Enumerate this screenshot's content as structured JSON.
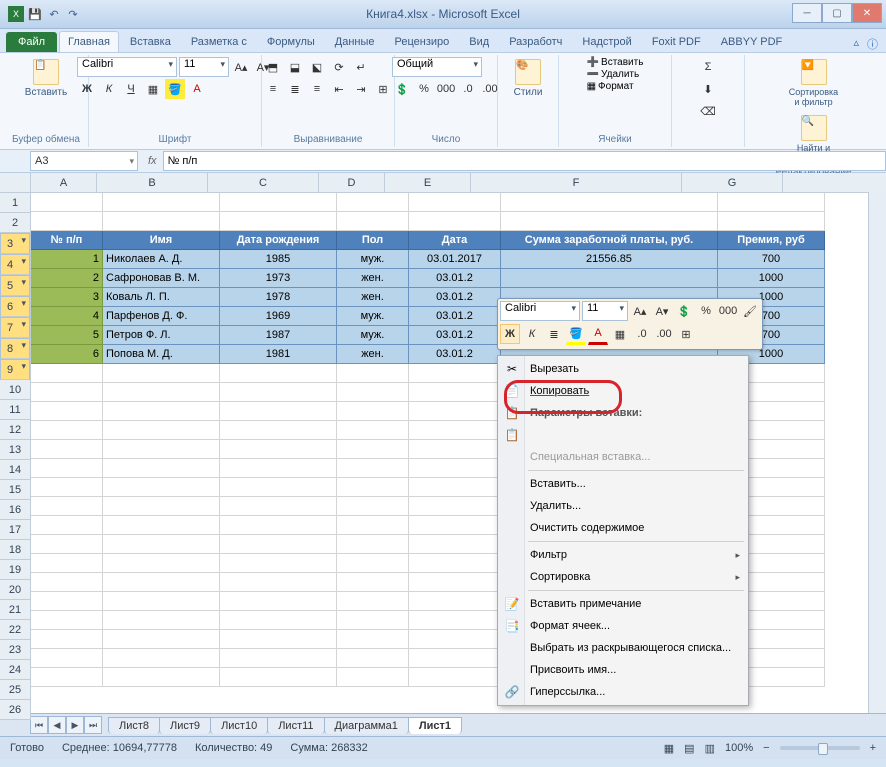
{
  "title": "Книга4.xlsx - Microsoft Excel",
  "tabs": {
    "file": "Файл",
    "home": "Главная",
    "insert": "Вставка",
    "layout": "Разметка с",
    "formulas": "Формулы",
    "data": "Данные",
    "review": "Рецензиро",
    "view": "Вид",
    "dev": "Разработч",
    "addin": "Надстрой",
    "foxit": "Foxit PDF",
    "abbyy": "ABBYY PDF"
  },
  "ribbon": {
    "clipboard": {
      "paste": "Вставить",
      "label": "Буфер обмена"
    },
    "font": {
      "name": "Calibri",
      "size": "11",
      "label": "Шрифт"
    },
    "align": {
      "label": "Выравнивание"
    },
    "number": {
      "fmt": "Общий",
      "label": "Число"
    },
    "styles": {
      "btn": "Стили"
    },
    "cells": {
      "insert": "Вставить",
      "delete": "Удалить",
      "format": "Формат",
      "label": "Ячейки"
    },
    "editing": {
      "sort": "Сортировка и фильтр",
      "find": "Найти и выделить",
      "label": "Редактирование"
    }
  },
  "namebox": "A3",
  "formula": "№ п/п",
  "cols": [
    "A",
    "B",
    "C",
    "D",
    "E",
    "F",
    "G"
  ],
  "header": [
    "№ п/п",
    "Имя",
    "Дата рождения",
    "Пол",
    "Дата",
    "Сумма заработной платы, руб.",
    "Премия, руб"
  ],
  "rows": [
    {
      "n": "1",
      "name": "Николаев А. Д.",
      "birth": "1985",
      "sex": "муж.",
      "date": "03.01.2017",
      "sum": "21556.85",
      "bonus": "700"
    },
    {
      "n": "2",
      "name": "Сафроновав В. М.",
      "birth": "1973",
      "sex": "жен.",
      "date": "03.01.2",
      "sum": "",
      "bonus": "1000"
    },
    {
      "n": "3",
      "name": "Коваль Л. П.",
      "birth": "1978",
      "sex": "жен.",
      "date": "03.01.2",
      "sum": "",
      "bonus": "1000"
    },
    {
      "n": "4",
      "name": "Парфенов Д. Ф.",
      "birth": "1969",
      "sex": "муж.",
      "date": "03.01.2",
      "sum": "",
      "bonus": "700"
    },
    {
      "n": "5",
      "name": "Петров Ф. Л.",
      "birth": "1987",
      "sex": "муж.",
      "date": "03.01.2",
      "sum": "",
      "bonus": "700"
    },
    {
      "n": "6",
      "name": "Попова М. Д.",
      "birth": "1981",
      "sex": "жен.",
      "date": "03.01.2",
      "sum": "",
      "bonus": "1000"
    }
  ],
  "minitool": {
    "font": "Calibri",
    "size": "11"
  },
  "ctx": {
    "cut": "Вырезать",
    "copy": "Копировать",
    "pasteopts": "Параметры вставки:",
    "pastespecial": "Специальная вставка...",
    "insert": "Вставить...",
    "delete": "Удалить...",
    "clear": "Очистить содержимое",
    "filter": "Фильтр",
    "sort": "Сортировка",
    "comment": "Вставить примечание",
    "fmt": "Формат ячеек...",
    "dropdown": "Выбрать из раскрывающегося списка...",
    "name": "Присвоить имя...",
    "link": "Гиперссылка..."
  },
  "sheets": [
    "Лист8",
    "Лист9",
    "Лист10",
    "Лист11",
    "Диаграмма1",
    "Лист1"
  ],
  "status": {
    "ready": "Готово",
    "avg": "Среднее: 10694,77778",
    "count": "Количество: 49",
    "sum": "Сумма: 268332",
    "zoom": "100%"
  }
}
